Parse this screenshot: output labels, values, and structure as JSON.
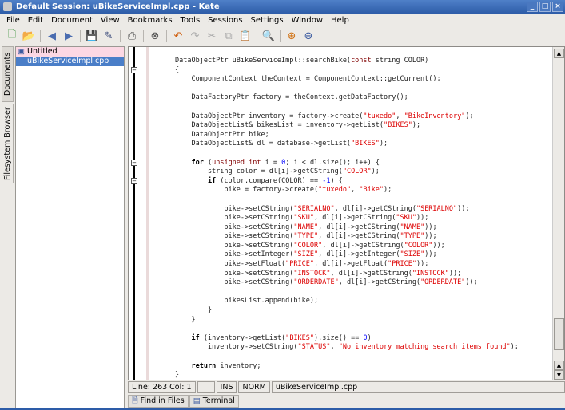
{
  "window": {
    "title": "Default Session: uBikeServiceImpl.cpp - Kate"
  },
  "menu": [
    "File",
    "Edit",
    "Document",
    "View",
    "Bookmarks",
    "Tools",
    "Sessions",
    "Settings",
    "Window",
    "Help"
  ],
  "toolbar": [
    "new-document-icon",
    "open-folder-icon",
    "back-arrow-icon",
    "forward-arrow-icon",
    "save-icon",
    "save-as-icon",
    "print-icon",
    "close-document-icon",
    "undo-icon",
    "redo-icon",
    "cut-icon",
    "copy-icon",
    "paste-icon",
    "find-icon",
    "zoom-in-icon",
    "zoom-out-icon"
  ],
  "side_tabs": {
    "documents": "Documents",
    "filesystem": "Filesystem Browser"
  },
  "documents": [
    {
      "name": "Untitled"
    },
    {
      "name": "uBikeServiceImpl.cpp"
    }
  ],
  "code": [
    [
      [
        "DataObjectPtr uBikeServiceImpl::searchBike(",
        ""
      ],
      [
        "const",
        "ty"
      ],
      [
        " string COLOR)",
        ""
      ]
    ],
    [
      [
        "{",
        ""
      ]
    ],
    [
      [
        "    ComponentContext theContext = ComponentContext::getCurrent();",
        ""
      ]
    ],
    [],
    [
      [
        "    DataFactoryPtr factory = theContext.getDataFactory();",
        ""
      ]
    ],
    [],
    [
      [
        "    DataObjectPtr inventory = factory->create(",
        ""
      ],
      [
        "\"tuxedo\"",
        "st"
      ],
      [
        ", ",
        ""
      ],
      [
        "\"BikeInventory\"",
        "st"
      ],
      [
        ");",
        ""
      ]
    ],
    [
      [
        "    DataObjectList& bikesList = inventory->getList(",
        ""
      ],
      [
        "\"BIKES\"",
        "st"
      ],
      [
        ");",
        ""
      ]
    ],
    [
      [
        "    DataObjectPtr bike;",
        ""
      ]
    ],
    [
      [
        "    DataObjectList& dl = database->getList(",
        ""
      ],
      [
        "\"BIKES\"",
        "st"
      ],
      [
        ");",
        ""
      ]
    ],
    [],
    [
      [
        "    ",
        ""
      ],
      [
        "for",
        "kw"
      ],
      [
        " (",
        ""
      ],
      [
        "unsigned int",
        "ty"
      ],
      [
        " i = ",
        ""
      ],
      [
        "0",
        "nu"
      ],
      [
        "; i < dl.size(); i++) {",
        ""
      ]
    ],
    [
      [
        "        string color = dl[i]->getCString(",
        ""
      ],
      [
        "\"COLOR\"",
        "st"
      ],
      [
        ");",
        ""
      ]
    ],
    [
      [
        "        ",
        ""
      ],
      [
        "if",
        "kw"
      ],
      [
        " (color.compare(COLOR) == ",
        ""
      ],
      [
        "-1",
        "nu"
      ],
      [
        ") {",
        ""
      ]
    ],
    [
      [
        "            bike = factory->create(",
        ""
      ],
      [
        "\"tuxedo\"",
        "st"
      ],
      [
        ", ",
        ""
      ],
      [
        "\"Bike\"",
        "st"
      ],
      [
        ");",
        ""
      ]
    ],
    [],
    [
      [
        "            bike->setCString(",
        ""
      ],
      [
        "\"SERIALNO\"",
        "st"
      ],
      [
        ", dl[i]->getCString(",
        ""
      ],
      [
        "\"SERIALNO\"",
        "st"
      ],
      [
        "));",
        ""
      ]
    ],
    [
      [
        "            bike->setCString(",
        ""
      ],
      [
        "\"SKU\"",
        "st"
      ],
      [
        ", dl[i]->getCString(",
        ""
      ],
      [
        "\"SKU\"",
        "st"
      ],
      [
        "));",
        ""
      ]
    ],
    [
      [
        "            bike->setCString(",
        ""
      ],
      [
        "\"NAME\"",
        "st"
      ],
      [
        ", dl[i]->getCString(",
        ""
      ],
      [
        "\"NAME\"",
        "st"
      ],
      [
        "));",
        ""
      ]
    ],
    [
      [
        "            bike->setCString(",
        ""
      ],
      [
        "\"TYPE\"",
        "st"
      ],
      [
        ", dl[i]->getCString(",
        ""
      ],
      [
        "\"TYPE\"",
        "st"
      ],
      [
        "));",
        ""
      ]
    ],
    [
      [
        "            bike->setCString(",
        ""
      ],
      [
        "\"COLOR\"",
        "st"
      ],
      [
        ", dl[i]->getCString(",
        ""
      ],
      [
        "\"COLOR\"",
        "st"
      ],
      [
        "));",
        ""
      ]
    ],
    [
      [
        "            bike->setInteger(",
        ""
      ],
      [
        "\"SIZE\"",
        "st"
      ],
      [
        ", dl[i]->getInteger(",
        ""
      ],
      [
        "\"SIZE\"",
        "st"
      ],
      [
        "));",
        ""
      ]
    ],
    [
      [
        "            bike->setFloat(",
        ""
      ],
      [
        "\"PRICE\"",
        "st"
      ],
      [
        ", dl[i]->getFloat(",
        ""
      ],
      [
        "\"PRICE\"",
        "st"
      ],
      [
        "));",
        ""
      ]
    ],
    [
      [
        "            bike->setCString(",
        ""
      ],
      [
        "\"INSTOCK\"",
        "st"
      ],
      [
        ", dl[i]->getCString(",
        ""
      ],
      [
        "\"INSTOCK\"",
        "st"
      ],
      [
        "));",
        ""
      ]
    ],
    [
      [
        "            bike->setCString(",
        ""
      ],
      [
        "\"ORDERDATE\"",
        "st"
      ],
      [
        ", dl[i]->getCString(",
        ""
      ],
      [
        "\"ORDERDATE\"",
        "st"
      ],
      [
        "));",
        ""
      ]
    ],
    [],
    [
      [
        "            bikesList.append(bike);",
        ""
      ]
    ],
    [
      [
        "        }",
        ""
      ]
    ],
    [
      [
        "    }",
        ""
      ]
    ],
    [],
    [
      [
        "    ",
        ""
      ],
      [
        "if",
        "kw"
      ],
      [
        " (inventory->getList(",
        ""
      ],
      [
        "\"BIKES\"",
        "st"
      ],
      [
        ").size() == ",
        ""
      ],
      [
        "0",
        "nu"
      ],
      [
        ")",
        ""
      ]
    ],
    [
      [
        "        inventory->setCString(",
        ""
      ],
      [
        "\"STATUS\"",
        "st"
      ],
      [
        ", ",
        ""
      ],
      [
        "\"No inventory matching search items found\"",
        "st"
      ],
      [
        ");",
        ""
      ]
    ],
    [],
    [
      [
        "    ",
        ""
      ],
      [
        "return",
        "kw"
      ],
      [
        " inventory;",
        ""
      ]
    ],
    [
      [
        "}",
        ""
      ]
    ]
  ],
  "status": {
    "position": "Line: 263 Col: 1",
    "blank": "",
    "mode": "INS",
    "input": "NORM",
    "file": "uBikeServiceImpl.cpp"
  },
  "bottom_tabs": [
    "Find in Files",
    "Terminal"
  ]
}
